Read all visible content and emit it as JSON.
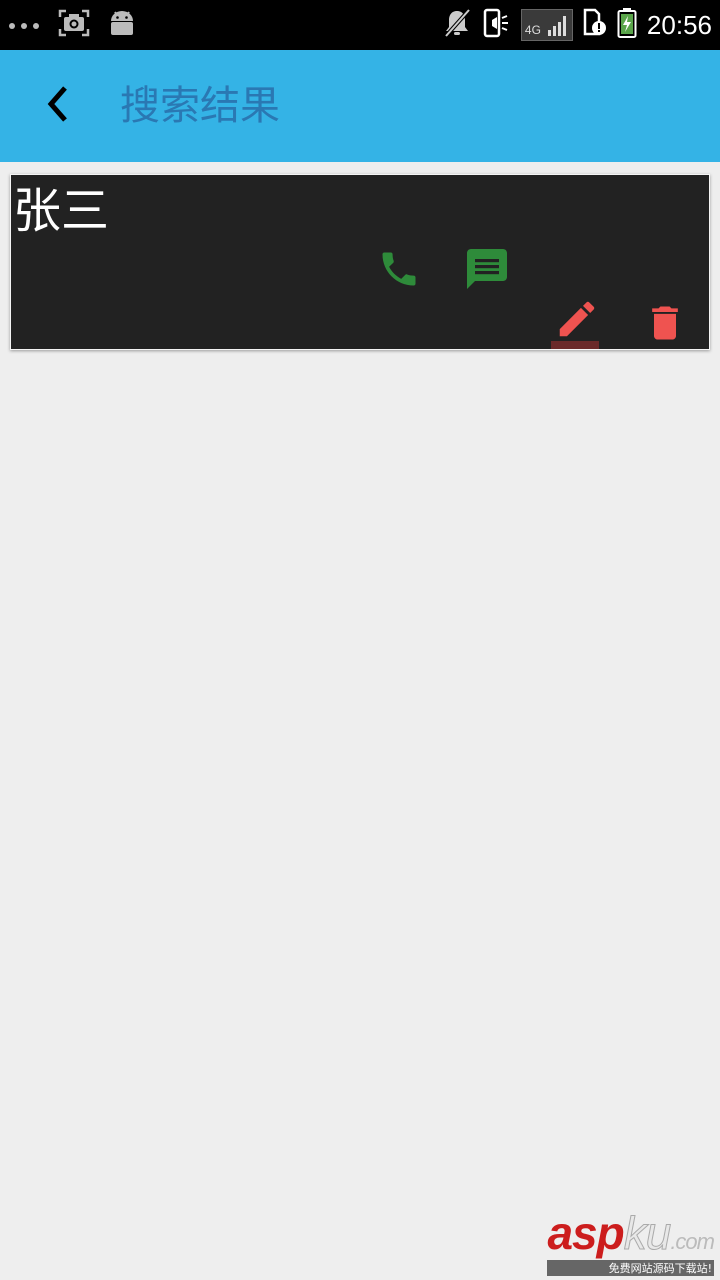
{
  "status_bar": {
    "time": "20:56",
    "network_label": "4G",
    "left_icons": [
      "more-dots-icon",
      "screenshot-camera-icon",
      "android-icon"
    ],
    "right_icons": [
      "notifications-off-icon",
      "vibrate-icon",
      "signal-icon",
      "sim-alert-icon",
      "battery-charging-icon"
    ]
  },
  "app_bar": {
    "title": "搜索结果",
    "back_icon": "chevron-left-icon",
    "background_color": "#34b3e6",
    "title_color": "#2a78b3"
  },
  "results": [
    {
      "name": "张三",
      "actions": [
        {
          "id": "call",
          "icon": "phone-icon",
          "color": "#2e8b3a"
        },
        {
          "id": "message",
          "icon": "message-icon",
          "color": "#2e8b3a"
        },
        {
          "id": "edit",
          "icon": "pencil-icon",
          "color": "#ef5350"
        },
        {
          "id": "delete",
          "icon": "trash-icon",
          "color": "#ef5350"
        }
      ]
    }
  ],
  "watermark": {
    "red_part": "asp",
    "grey_part": "ku",
    "suffix": ".com",
    "subtitle": "免费网站源码下载站!"
  }
}
